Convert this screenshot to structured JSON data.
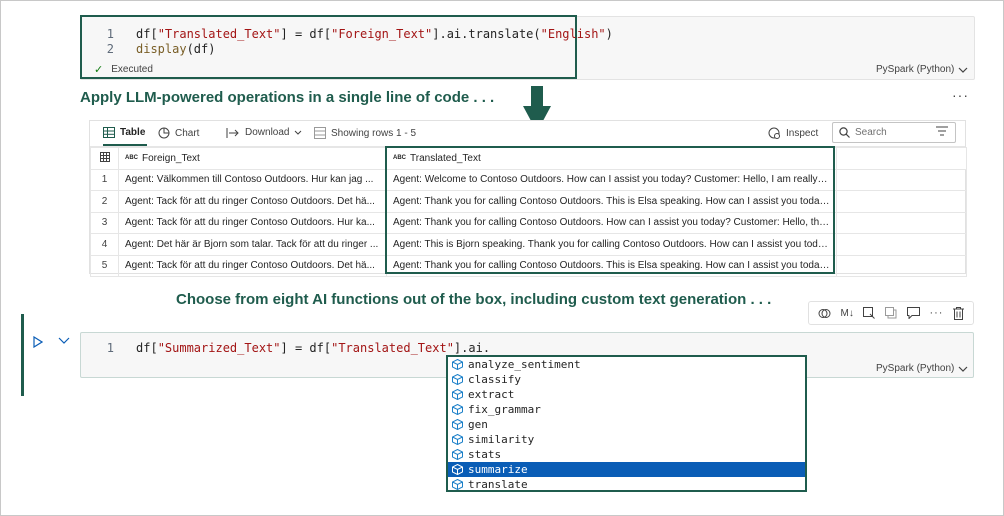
{
  "top_cell": {
    "lines": [
      {
        "num": "1",
        "p1": "df[",
        "s1": "\"Translated_Text\"",
        "p2": "] = df[",
        "s2": "\"Foreign_Text\"",
        "p3": "].ai.translate(",
        "s3": "\"English\"",
        "p4": ")"
      },
      {
        "num": "2",
        "fn": "display",
        "rest": "(df)"
      }
    ],
    "status": "Executed",
    "language": "PySpark (Python)"
  },
  "caption1": "Apply LLM-powered operations in a single line of code . . .",
  "caption2": "Choose from eight AI functions out of the box, including custom text generation . . .",
  "more_label": "···",
  "result_toolbar": {
    "table_label": "Table",
    "chart_label": "Chart",
    "download_label": "Download",
    "rows_label": "Showing rows 1 - 5",
    "inspect_label": "Inspect",
    "search_placeholder": "Search"
  },
  "table": {
    "columns": [
      "Foreign_Text",
      "Translated_Text"
    ],
    "column_type": "ABC",
    "rows": [
      {
        "idx": "1",
        "foreign": "Agent: Välkommen till Contoso Outdoors. Hur kan jag ...",
        "translated": "Agent: Welcome to Contoso Outdoors. How can I assist you today? Customer: Hello, I am really di..."
      },
      {
        "idx": "2",
        "foreign": "Agent: Tack för att du ringer Contoso Outdoors. Det hä...",
        "translated": "Agent: Thank you for calling Contoso Outdoors. This is Elsa speaking. How can I assist you today?..."
      },
      {
        "idx": "3",
        "foreign": "Agent: Tack för att du ringer Contoso Outdoors. Hur ka...",
        "translated": "Agent: Thank you for calling Contoso Outdoors. How can I assist you today? Customer: Hello, this..."
      },
      {
        "idx": "4",
        "foreign": "Agent: Det här är Bjorn som talar. Tack för att du ringer ...",
        "translated": "Agent: This is Bjorn speaking. Thank you for calling Contoso Outdoors. How can I assist you today..."
      },
      {
        "idx": "5",
        "foreign": "Agent: Tack för att du ringer Contoso Outdoors. Det hä...",
        "translated": "Agent: Thank you for calling Contoso Outdoors. This is Elsa speaking. How can I assist you today?..."
      }
    ]
  },
  "bottom_cell": {
    "line_num": "1",
    "p1": "df[",
    "s1": "\"Summarized_Text\"",
    "p2": "] = df[",
    "s2": "\"Translated_Text\"",
    "p3": "].ai.",
    "language": "PySpark (Python)"
  },
  "suggestions": {
    "items": [
      "analyze_sentiment",
      "classify",
      "extract",
      "fix_grammar",
      "gen",
      "similarity",
      "stats",
      "summarize",
      "translate"
    ],
    "selected": "summarize"
  },
  "colors": {
    "accent": "#1f5c4d",
    "selection": "#0a5db6",
    "string": "#a31515",
    "function": "#795e26"
  }
}
